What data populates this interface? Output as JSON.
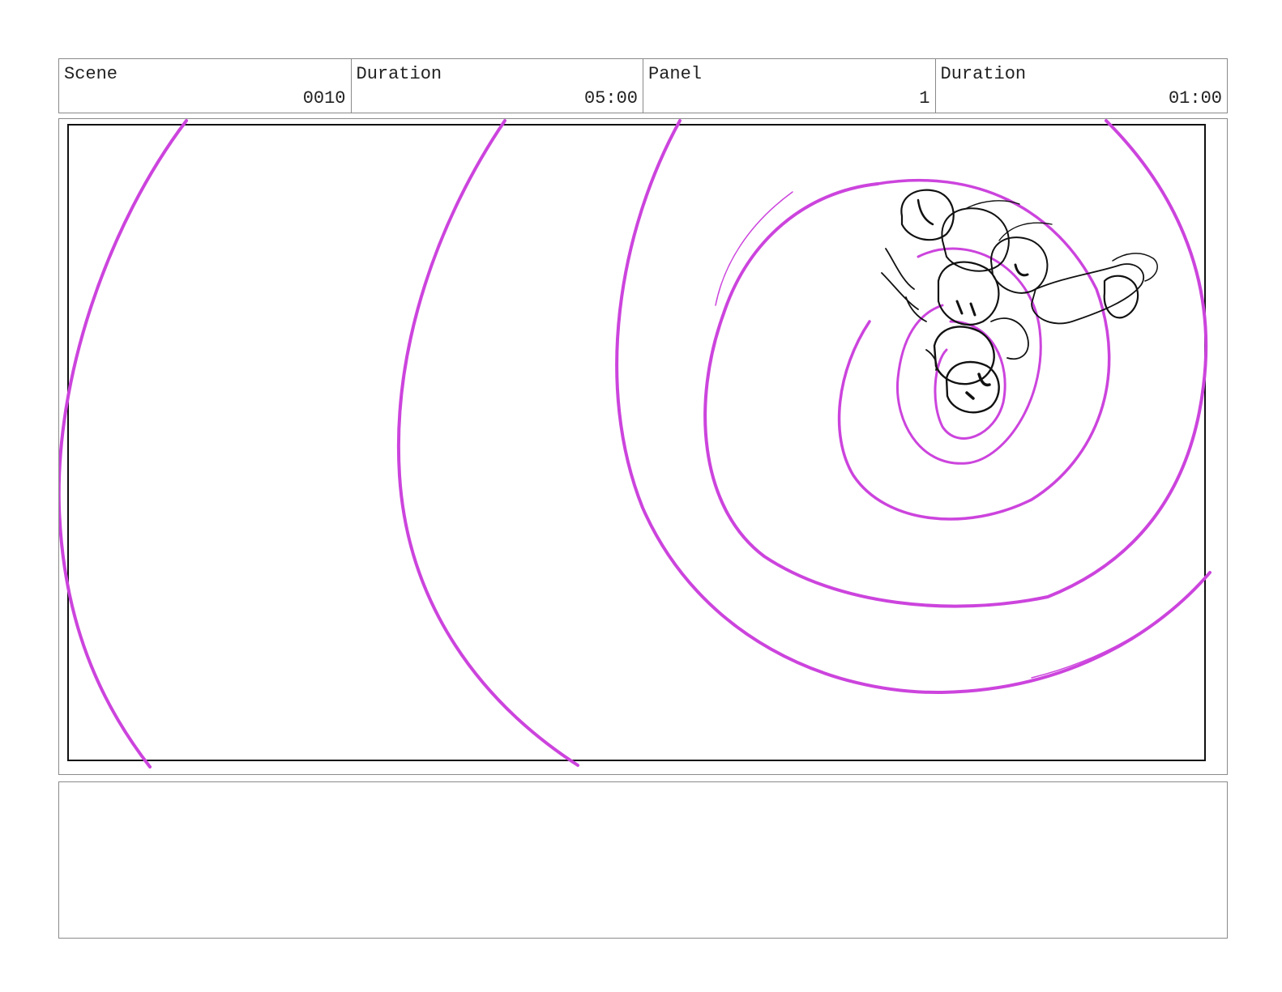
{
  "header": {
    "cells": [
      {
        "label": "Scene",
        "value": "0010"
      },
      {
        "label": "Duration",
        "value": "05:00"
      },
      {
        "label": "Panel",
        "value": "1"
      },
      {
        "label": "Duration",
        "value": "01:00"
      }
    ]
  },
  "panel": {
    "spiral_color": "#cc44dd",
    "sketch_color": "#111111"
  },
  "notes": {
    "text": ""
  }
}
